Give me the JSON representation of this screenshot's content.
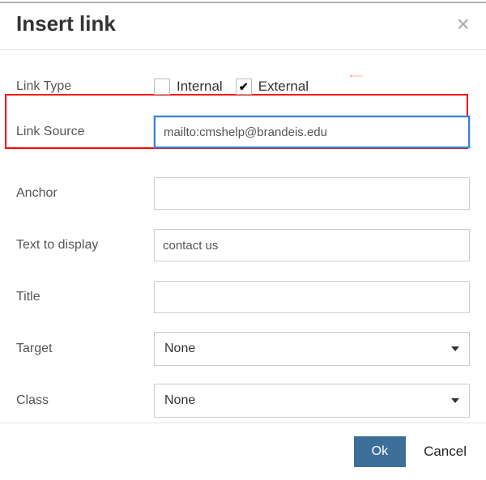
{
  "header": {
    "title": "Insert link"
  },
  "fields": {
    "linkType": {
      "label": "Link Type",
      "internal_label": "Internal",
      "external_label": "External",
      "internal_checked": false,
      "external_checked": true
    },
    "linkSource": {
      "label": "Link Source",
      "value": "mailto:cmshelp@brandeis.edu"
    },
    "anchor": {
      "label": "Anchor",
      "value": ""
    },
    "textToDisplay": {
      "label": "Text to display",
      "value": "contact us"
    },
    "title": {
      "label": "Title",
      "value": ""
    },
    "target": {
      "label": "Target",
      "selected": "None"
    },
    "cssClass": {
      "label": "Class",
      "selected": "None"
    }
  },
  "footer": {
    "ok": "Ok",
    "cancel": "Cancel"
  }
}
